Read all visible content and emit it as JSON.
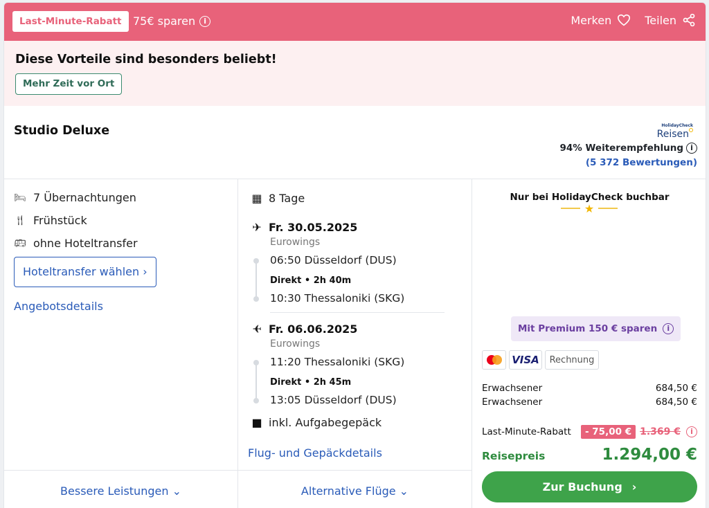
{
  "topbar": {
    "badge": "Last-Minute-Rabatt",
    "savings": "75€ sparen",
    "save_action": "Merken",
    "share_action": "Teilen"
  },
  "benefits": {
    "title": "Diese Vorteile sind besonders beliebt!",
    "chip": "Mehr Zeit vor Ort"
  },
  "room": {
    "name": "Studio Deluxe",
    "brand_small": "HolidayCheck",
    "brand": "Reisen",
    "recommendation": "94% Weiterempfehlung",
    "reviews": "(5 372 Bewertungen)"
  },
  "features": {
    "nights": "7 Übernachtungen",
    "board": "Frühstück",
    "transfer": "ohne Hoteltransfer",
    "transfer_button": "Hoteltransfer wählen ›",
    "offer_details": "Angebotsdetails",
    "better_services": "Bessere Leistungen ⌄"
  },
  "flights": {
    "duration": "8 Tage",
    "outbound": {
      "date": "Fr. 30.05.2025",
      "airline": "Eurowings",
      "depart": "06:50 Düsseldorf (DUS)",
      "direct": "Direkt • 2h 40m",
      "arrive": "10:30 Thessaloniki (SKG)"
    },
    "return": {
      "date": "Fr. 06.06.2025",
      "airline": "Eurowings",
      "depart": "11:20 Thessaloniki (SKG)",
      "direct": "Direkt • 2h 45m",
      "arrive": "13:05 Düsseldorf (DUS)"
    },
    "baggage": "inkl. Aufgabegepäck",
    "details_link": "Flug- und Gepäckdetails",
    "alternatives": "Alternative Flüge ⌄"
  },
  "pricing": {
    "exclusive": "Nur bei HolidayCheck buchbar",
    "premium": "Mit Premium 150 € sparen",
    "payment": [
      "Mastercard",
      "VISA",
      "Rechnung"
    ],
    "travelers": [
      {
        "label": "Erwachsener",
        "price": "684,50 €"
      },
      {
        "label": "Erwachsener",
        "price": "684,50 €"
      }
    ],
    "discount_label": "Last-Minute-Rabatt",
    "discount": "- 75,00 €",
    "old_price": "1.369 €",
    "total_label": "Reisepreis",
    "total": "1.294,00 €",
    "book_button": "Zur Buchung",
    "accent": "#e8627a",
    "green": "#3ea34a"
  }
}
